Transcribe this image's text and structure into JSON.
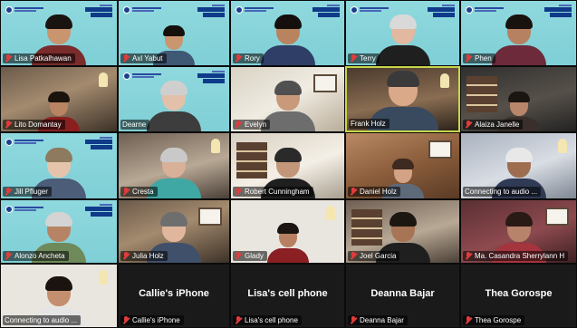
{
  "participants": [
    {
      "name": "Lisa Patkalhawan",
      "bg": "bg-cyan",
      "branded": true,
      "muted": true,
      "skin": "#c8956f",
      "hair": "#1a1410",
      "shirt": "#7a2c2c"
    },
    {
      "name": "Axl Yabut",
      "bg": "bg-cyan",
      "branded": true,
      "muted": true,
      "skin": "#c9966f",
      "hair": "#16100c",
      "shirt": "#3f5874"
    },
    {
      "name": "Rory",
      "bg": "bg-cyan",
      "branded": true,
      "muted": true,
      "skin": "#b98360",
      "hair": "#15100d",
      "shirt": "#2e3e66"
    },
    {
      "name": "Terry",
      "bg": "bg-cyan",
      "branded": true,
      "muted": true,
      "skin": "#e2b8a0",
      "hair": "#d9d9d9",
      "shirt": "#1f1f1f"
    },
    {
      "name": "Phen",
      "bg": "bg-cyan",
      "branded": true,
      "muted": true,
      "skin": "#b58160",
      "hair": "#18120e",
      "shirt": "#6c2a3a"
    },
    {
      "name": "Lito Domantay",
      "bg": "bg-room1",
      "branded": false,
      "muted": true,
      "skin": "#b88462",
      "hair": "#1a130e",
      "shirt": "#8b1f1f"
    },
    {
      "name": "Dearne",
      "bg": "bg-cyan",
      "branded": true,
      "muted": false,
      "skin": "#e3c0aa",
      "hair": "#cfcfcf",
      "shirt": "#3d3d3d"
    },
    {
      "name": "Evelyn",
      "bg": "bg-room2",
      "branded": false,
      "muted": true,
      "skin": "#c89a7a",
      "hair": "#505050",
      "shirt": "#6d6d6d"
    },
    {
      "name": "Frank Holz",
      "bg": "bg-room3",
      "branded": false,
      "muted": false,
      "active": true,
      "skin": "#d9a98a",
      "hair": "#3a3a3a",
      "shirt": "#3a4a5e"
    },
    {
      "name": "Alaiza Janelle",
      "bg": "bg-room4",
      "branded": false,
      "muted": true,
      "skin": "#b8866a",
      "hair": "#1b1512",
      "shirt": "#3a2f2a"
    },
    {
      "name": "Jill Pfluger",
      "bg": "bg-cyan",
      "branded": true,
      "muted": true,
      "skin": "#e6c4ac",
      "hair": "#8e7a5e",
      "shirt": "#4b5d78"
    },
    {
      "name": "Cresta",
      "bg": "bg-room7",
      "branded": false,
      "muted": true,
      "skin": "#d9b199",
      "hair": "#c9c9c9",
      "shirt": "#3fa7a4"
    },
    {
      "name": "Robert Cunningham",
      "bg": "bg-room8",
      "branded": false,
      "muted": true,
      "skin": "#c49679",
      "hair": "#2a2a2a",
      "shirt": "#1f1f1f"
    },
    {
      "name": "Daniel Holz",
      "bg": "bg-room5",
      "branded": false,
      "muted": true,
      "skin": "#d4a284",
      "hair": "#3d2a20",
      "shirt": "#5d6a7a"
    },
    {
      "name": "Connecting to audio ...",
      "bg": "bg-room6",
      "branded": false,
      "muted": false,
      "skin": "#9e6d50",
      "hair": "#e8e8e8",
      "shirt": "#2f3a55"
    },
    {
      "name": "Alonzo Ancheta",
      "bg": "bg-cyan",
      "branded": true,
      "muted": true,
      "skin": "#b68464",
      "hair": "#d4d4d4",
      "shirt": "#6e8a5a"
    },
    {
      "name": "Julia Holz",
      "bg": "bg-room1",
      "branded": false,
      "muted": true,
      "skin": "#e0b79d",
      "hair": "#6e6e6e",
      "shirt": "#40506a"
    },
    {
      "name": "Glady",
      "bg": "bg-plain",
      "branded": false,
      "muted": true,
      "skin": "#b88063",
      "hair": "#1c1410",
      "shirt": "#8a1f24"
    },
    {
      "name": "Joel Garcia",
      "bg": "bg-room7",
      "branded": false,
      "muted": true,
      "skin": "#a77455",
      "hair": "#1d1712",
      "shirt": "#1f1f1f"
    },
    {
      "name": "Ma. Casandra Sherrylann H",
      "bg": "bg-room9",
      "branded": false,
      "muted": true,
      "skin": "#b7836a",
      "hair": "#2a1a16",
      "shirt": "#a4343d"
    },
    {
      "name": "Connecting to audio ...",
      "bg": "bg-plain",
      "branded": false,
      "muted": false,
      "skin": "#c48f6e",
      "hair": "#1a130f",
      "shirt": "#e5e5e5"
    },
    {
      "name": "Callie's iPhone",
      "display": "Callie's iPhone",
      "bg": "bg-dark",
      "branded": false,
      "muted": true,
      "video_off": true
    },
    {
      "name": "Lisa's cell phone",
      "display": "Lisa's cell phone",
      "bg": "bg-dark",
      "branded": false,
      "muted": true,
      "video_off": true
    },
    {
      "name": "Deanna Bajar",
      "display": "Deanna Bajar",
      "bg": "bg-dark",
      "branded": false,
      "muted": true,
      "video_off": true
    },
    {
      "name": "Thea Gorospe",
      "display": "Thea Gorospe",
      "bg": "bg-dark",
      "branded": false,
      "muted": true,
      "video_off": true
    }
  ],
  "colors": {
    "active_speaker_border": "#c8d64a",
    "muted_icon": "#e23b3b",
    "brand_cyan": "#8fd9de"
  }
}
